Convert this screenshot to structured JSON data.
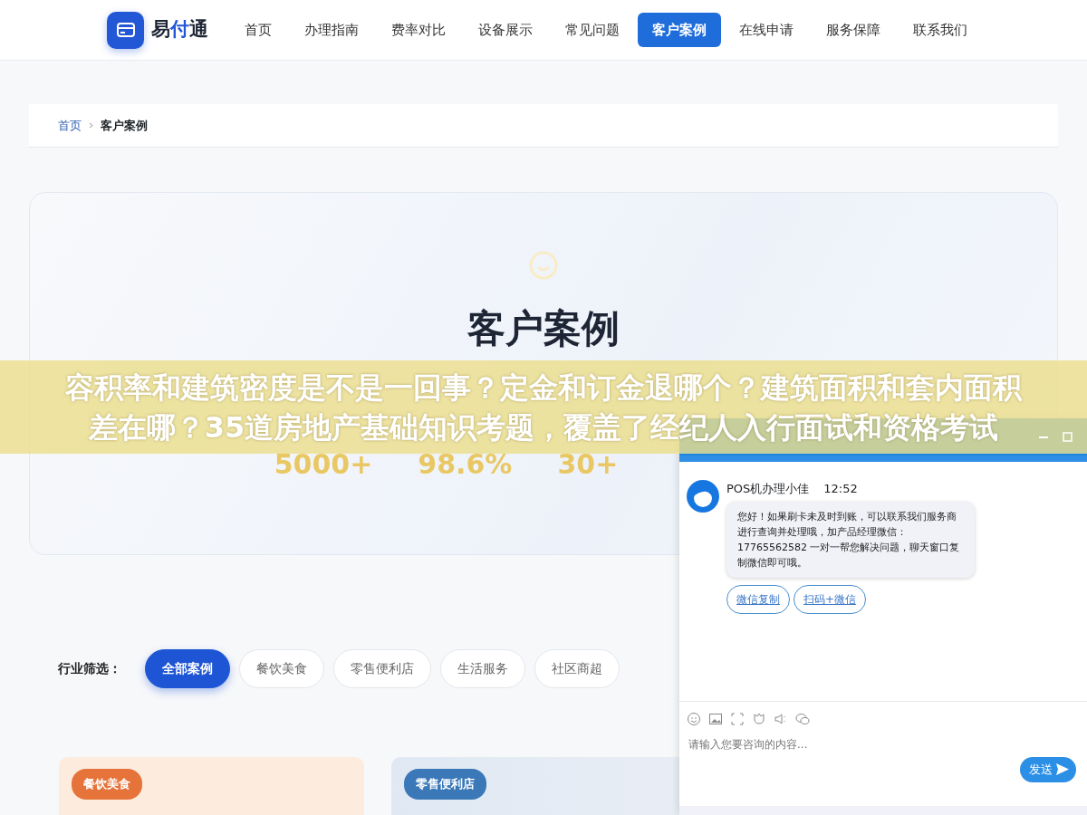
{
  "brand": {
    "prefix": "易",
    "accent": "付",
    "suffix": "通"
  },
  "nav": [
    {
      "label": "首页",
      "selected": false
    },
    {
      "label": "办理指南",
      "selected": false
    },
    {
      "label": "费率对比",
      "selected": false
    },
    {
      "label": "设备展示",
      "selected": false
    },
    {
      "label": "常见问题",
      "selected": false
    },
    {
      "label": "客户案例",
      "selected": true
    },
    {
      "label": "在线申请",
      "selected": false
    },
    {
      "label": "服务保障",
      "selected": false
    },
    {
      "label": "联系我们",
      "selected": false
    }
  ],
  "breadcrumb": [
    {
      "label": "首页",
      "kind": "link"
    },
    {
      "label": "客户案例",
      "kind": "current"
    }
  ],
  "hero": {
    "title": "客户案例",
    "stats": [
      "5000+",
      "98.6%",
      "30+"
    ]
  },
  "filter": {
    "label": "行业筛选：",
    "options": [
      {
        "label": "全部案例",
        "selected": true
      },
      {
        "label": "餐饮美食",
        "selected": false
      },
      {
        "label": "零售便利店",
        "selected": false
      },
      {
        "label": "生活服务",
        "selected": false
      },
      {
        "label": "社区商超",
        "selected": false
      }
    ]
  },
  "cases": [
    {
      "tag": "餐饮美食",
      "color": "#e5733a"
    },
    {
      "tag": "零售便利店",
      "color": "#3a78b8"
    }
  ],
  "banner": "容积率和建筑密度是不是一回事？定金和订金退哪个？建筑面积和套内面积差在哪？35道房地产基础知识考题，覆盖了经纪人入行面试和资格考试",
  "chat": {
    "sender": "POS机办理小佳",
    "time": "12:52",
    "message": "您好！如果刷卡未及时到账，可以联系我们服务商进行查询并处理哦，加产品经理微信：17765562582 一对一帮您解决问题，聊天窗口复制微信即可哦。",
    "actions": [
      "微信复制",
      "扫码+微信"
    ],
    "placeholder": "请输入您要咨询的内容...",
    "send": "发送"
  }
}
